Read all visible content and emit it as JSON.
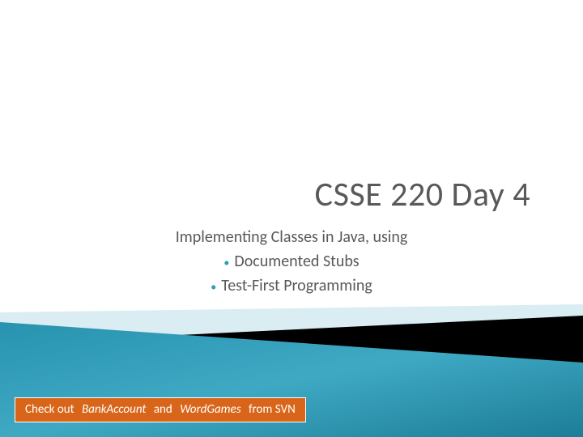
{
  "title": "CSSE 220 Day 4",
  "subtitle": {
    "main": "Implementing Classes in Java, using",
    "bullets": [
      "Documented Stubs",
      "Test-First Programming"
    ]
  },
  "callout": {
    "prefix": "Check out",
    "item1": "BankAccount",
    "middle": "and",
    "item2": "WordGames",
    "suffix": "from SVN"
  },
  "colors": {
    "darkTeal": "#0f6d85",
    "lightTeal": "#4fb3cf",
    "paleTeal": "#d9edf3",
    "black": "#000000",
    "orange": "#d9651a"
  }
}
